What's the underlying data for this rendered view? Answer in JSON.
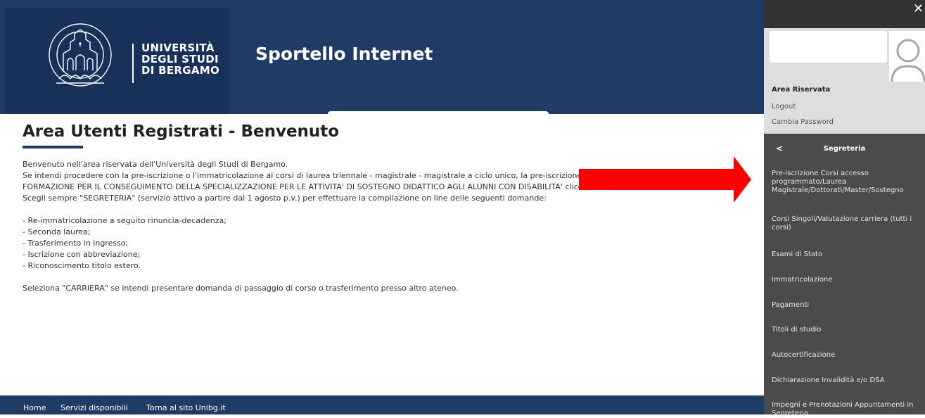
{
  "header": {
    "university_name": [
      "UNIVERSITÀ",
      "DEGLI STUDI",
      "DI BERGAMO"
    ],
    "seal_text": "STUDIORUM BERGOMENSIS",
    "app_title": "Sportello Internet",
    "colors": {
      "header": "#1f3b66",
      "logo_block": "#17315a"
    }
  },
  "main": {
    "title": "Area Utenti Registrati - Benvenuto",
    "paragraphs": [
      "Benvenuto nell'area riservata dell'Università degli Studi di Bergamo.",
      "Se intendi procedere con la pre-iscrizione o l'immatricolazione ai corsi di laurea triennale - magistrale - magistrale a ciclo unico, la pre-iscrizione a",
      "FORMAZIONE PER IL CONSEGUIMENTO DELLA SPECIALIZZAZIONE PER LE ATTIVITA' DI SOSTEGNO DIDATTICO AGLI ALUNNI CON DISABILITA' clicca su",
      "Scegli sempre \"SEGRETERIA\" (servizio attivo a partire dal 1 agosto p.v.) per effettuare la compilazione on line delle seguenti domande:"
    ],
    "list": [
      "- Re-immatricolazione a seguito rinuncia-decadenza;",
      "- Seconda laurea;",
      "- Trasferimento in ingresso;",
      "- Iscrizione con abbreviazione;",
      "- Riconoscimento titolo estero."
    ],
    "closing": "Seleziona \"CARRIERA\" se intendi presentare domanda di passaggio di corso o trasferimento presso altro ateneo."
  },
  "footer": {
    "home": "Home",
    "services": "Servizi disponibili",
    "back_to_site": "Torna al sito Unibg.it"
  },
  "annotation": {
    "arrow_color": "#ff0000",
    "arrow_icon": "right-arrow-icon"
  },
  "side_panel": {
    "close_icon": "close-icon",
    "area_label": "Area Riservata",
    "logout": "Logout",
    "change_password": "Cambia Password",
    "section_title": "Segreteria",
    "back_icon": "chevron-left-icon",
    "menu": [
      "Pre-iscrizione Corsi accesso programmato/Laurea Magistrale/Dottorati/Master/Sostegno",
      "Corsi Singoli/Valutazione carriera (tutti i corsi)",
      "Esami di Stato",
      "Immatricolazione",
      "Pagamenti",
      "Titoli di studio",
      "Autocertificazione",
      "Dichiarazione Invalidità e/o DSA",
      "Impegni e Prenotazioni Appuntamenti in Segreteria"
    ]
  }
}
